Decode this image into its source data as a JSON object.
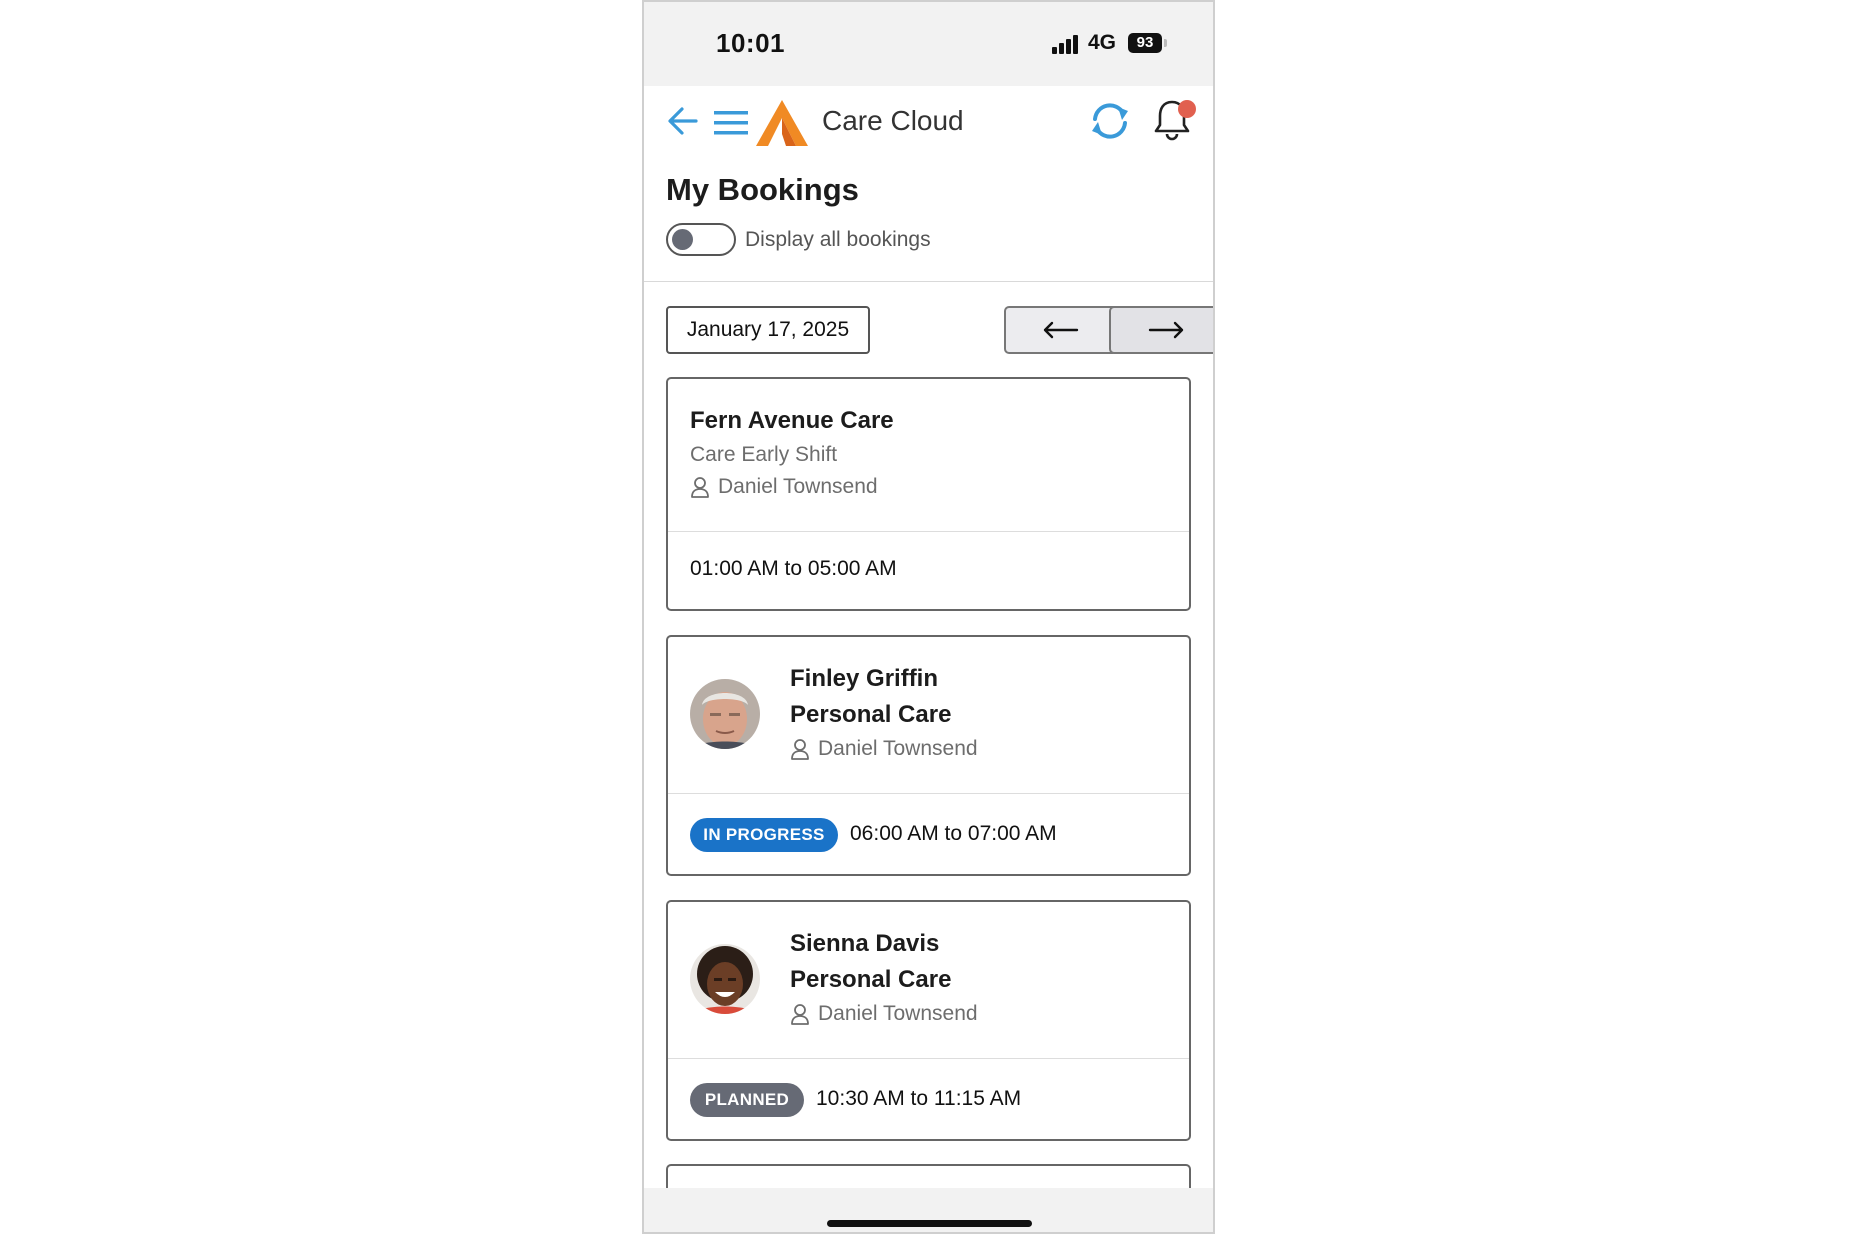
{
  "status_bar": {
    "time": "10:01",
    "network": "4G",
    "battery": "93"
  },
  "app_bar": {
    "title": "Care Cloud"
  },
  "page": {
    "title": "My Bookings",
    "toggle_label": "Display all bookings",
    "toggle_on": false,
    "date": "January 17, 2025"
  },
  "bookings": [
    {
      "title": "Fern Avenue Care",
      "subtitle": "Care Early Shift",
      "carer": "Daniel Townsend",
      "time": "01:00 AM to 05:00 AM"
    },
    {
      "client": "Finley Griffin",
      "service": "Personal Care",
      "carer": "Daniel Townsend",
      "status": "IN PROGRESS",
      "time": "06:00 AM to 07:00 AM"
    },
    {
      "client": "Sienna Davis",
      "service": "Personal Care",
      "carer": "Daniel Townsend",
      "status": "PLANNED",
      "time": "10:30 AM to 11:15 AM"
    }
  ],
  "colors": {
    "accent_blue": "#3a9ad9",
    "logo_orange": "#f08a24",
    "in_progress": "#1a73c8",
    "planned": "#666a75",
    "notification_dot": "#e1604f"
  },
  "icons": [
    "back-arrow-icon",
    "hamburger-menu-icon",
    "care-cloud-logo-icon",
    "sync-icon",
    "bell-icon",
    "arrow-left-icon",
    "arrow-right-icon",
    "person-icon"
  ]
}
